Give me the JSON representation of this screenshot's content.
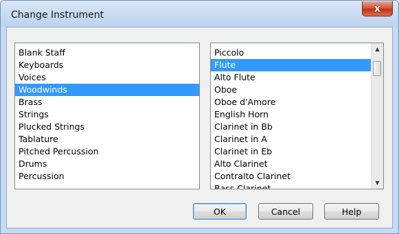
{
  "window": {
    "title": "Change Instrument",
    "close_glyph": "x"
  },
  "families": {
    "items": [
      {
        "label": "Blank Staff",
        "selected": false
      },
      {
        "label": "Keyboards",
        "selected": false
      },
      {
        "label": "Voices",
        "selected": false
      },
      {
        "label": "Woodwinds",
        "selected": true
      },
      {
        "label": "Brass",
        "selected": false
      },
      {
        "label": "Strings",
        "selected": false
      },
      {
        "label": "Plucked Strings",
        "selected": false
      },
      {
        "label": "Tablature",
        "selected": false
      },
      {
        "label": "Pitched Percussion",
        "selected": false
      },
      {
        "label": "Drums",
        "selected": false
      },
      {
        "label": "Percussion",
        "selected": false
      }
    ]
  },
  "instruments": {
    "items": [
      {
        "label": "Piccolo",
        "selected": false
      },
      {
        "label": "Flute",
        "selected": true
      },
      {
        "label": "Alto Flute",
        "selected": false
      },
      {
        "label": "Oboe",
        "selected": false
      },
      {
        "label": "Oboe d'Amore",
        "selected": false
      },
      {
        "label": "English Horn",
        "selected": false
      },
      {
        "label": "Clarinet in Bb",
        "selected": false
      },
      {
        "label": "Clarinet in A",
        "selected": false
      },
      {
        "label": "Clarinet in Eb",
        "selected": false
      },
      {
        "label": "Alto Clarinet",
        "selected": false
      },
      {
        "label": "Contralto Clarinet",
        "selected": false
      },
      {
        "label": "Bass Clarinet",
        "selected": false
      }
    ],
    "scroll_up_glyph": "▲",
    "scroll_down_glyph": "▼"
  },
  "buttons": {
    "ok": "OK",
    "cancel": "Cancel",
    "help": "Help"
  },
  "colors": {
    "selection": "#3399ff",
    "close_button": "#c53016"
  }
}
